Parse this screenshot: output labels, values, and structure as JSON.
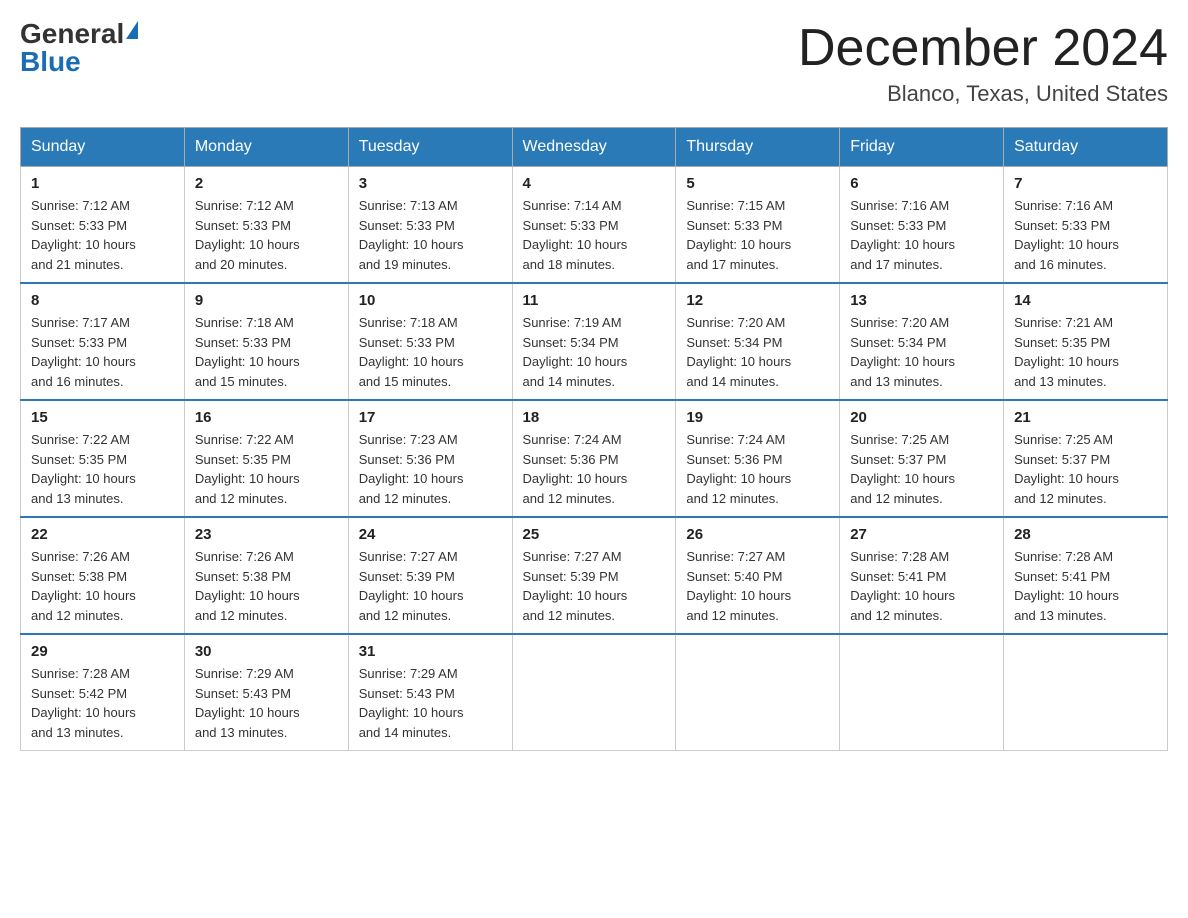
{
  "header": {
    "logo_general": "General",
    "logo_blue": "Blue",
    "title": "December 2024",
    "location": "Blanco, Texas, United States"
  },
  "days_of_week": [
    "Sunday",
    "Monday",
    "Tuesday",
    "Wednesday",
    "Thursday",
    "Friday",
    "Saturday"
  ],
  "weeks": [
    [
      {
        "day": "1",
        "sunrise": "7:12 AM",
        "sunset": "5:33 PM",
        "daylight": "10 hours and 21 minutes."
      },
      {
        "day": "2",
        "sunrise": "7:12 AM",
        "sunset": "5:33 PM",
        "daylight": "10 hours and 20 minutes."
      },
      {
        "day": "3",
        "sunrise": "7:13 AM",
        "sunset": "5:33 PM",
        "daylight": "10 hours and 19 minutes."
      },
      {
        "day": "4",
        "sunrise": "7:14 AM",
        "sunset": "5:33 PM",
        "daylight": "10 hours and 18 minutes."
      },
      {
        "day": "5",
        "sunrise": "7:15 AM",
        "sunset": "5:33 PM",
        "daylight": "10 hours and 17 minutes."
      },
      {
        "day": "6",
        "sunrise": "7:16 AM",
        "sunset": "5:33 PM",
        "daylight": "10 hours and 17 minutes."
      },
      {
        "day": "7",
        "sunrise": "7:16 AM",
        "sunset": "5:33 PM",
        "daylight": "10 hours and 16 minutes."
      }
    ],
    [
      {
        "day": "8",
        "sunrise": "7:17 AM",
        "sunset": "5:33 PM",
        "daylight": "10 hours and 16 minutes."
      },
      {
        "day": "9",
        "sunrise": "7:18 AM",
        "sunset": "5:33 PM",
        "daylight": "10 hours and 15 minutes."
      },
      {
        "day": "10",
        "sunrise": "7:18 AM",
        "sunset": "5:33 PM",
        "daylight": "10 hours and 15 minutes."
      },
      {
        "day": "11",
        "sunrise": "7:19 AM",
        "sunset": "5:34 PM",
        "daylight": "10 hours and 14 minutes."
      },
      {
        "day": "12",
        "sunrise": "7:20 AM",
        "sunset": "5:34 PM",
        "daylight": "10 hours and 14 minutes."
      },
      {
        "day": "13",
        "sunrise": "7:20 AM",
        "sunset": "5:34 PM",
        "daylight": "10 hours and 13 minutes."
      },
      {
        "day": "14",
        "sunrise": "7:21 AM",
        "sunset": "5:35 PM",
        "daylight": "10 hours and 13 minutes."
      }
    ],
    [
      {
        "day": "15",
        "sunrise": "7:22 AM",
        "sunset": "5:35 PM",
        "daylight": "10 hours and 13 minutes."
      },
      {
        "day": "16",
        "sunrise": "7:22 AM",
        "sunset": "5:35 PM",
        "daylight": "10 hours and 12 minutes."
      },
      {
        "day": "17",
        "sunrise": "7:23 AM",
        "sunset": "5:36 PM",
        "daylight": "10 hours and 12 minutes."
      },
      {
        "day": "18",
        "sunrise": "7:24 AM",
        "sunset": "5:36 PM",
        "daylight": "10 hours and 12 minutes."
      },
      {
        "day": "19",
        "sunrise": "7:24 AM",
        "sunset": "5:36 PM",
        "daylight": "10 hours and 12 minutes."
      },
      {
        "day": "20",
        "sunrise": "7:25 AM",
        "sunset": "5:37 PM",
        "daylight": "10 hours and 12 minutes."
      },
      {
        "day": "21",
        "sunrise": "7:25 AM",
        "sunset": "5:37 PM",
        "daylight": "10 hours and 12 minutes."
      }
    ],
    [
      {
        "day": "22",
        "sunrise": "7:26 AM",
        "sunset": "5:38 PM",
        "daylight": "10 hours and 12 minutes."
      },
      {
        "day": "23",
        "sunrise": "7:26 AM",
        "sunset": "5:38 PM",
        "daylight": "10 hours and 12 minutes."
      },
      {
        "day": "24",
        "sunrise": "7:27 AM",
        "sunset": "5:39 PM",
        "daylight": "10 hours and 12 minutes."
      },
      {
        "day": "25",
        "sunrise": "7:27 AM",
        "sunset": "5:39 PM",
        "daylight": "10 hours and 12 minutes."
      },
      {
        "day": "26",
        "sunrise": "7:27 AM",
        "sunset": "5:40 PM",
        "daylight": "10 hours and 12 minutes."
      },
      {
        "day": "27",
        "sunrise": "7:28 AM",
        "sunset": "5:41 PM",
        "daylight": "10 hours and 12 minutes."
      },
      {
        "day": "28",
        "sunrise": "7:28 AM",
        "sunset": "5:41 PM",
        "daylight": "10 hours and 13 minutes."
      }
    ],
    [
      {
        "day": "29",
        "sunrise": "7:28 AM",
        "sunset": "5:42 PM",
        "daylight": "10 hours and 13 minutes."
      },
      {
        "day": "30",
        "sunrise": "7:29 AM",
        "sunset": "5:43 PM",
        "daylight": "10 hours and 13 minutes."
      },
      {
        "day": "31",
        "sunrise": "7:29 AM",
        "sunset": "5:43 PM",
        "daylight": "10 hours and 14 minutes."
      },
      null,
      null,
      null,
      null
    ]
  ],
  "labels": {
    "sunrise": "Sunrise:",
    "sunset": "Sunset:",
    "daylight": "Daylight:"
  }
}
